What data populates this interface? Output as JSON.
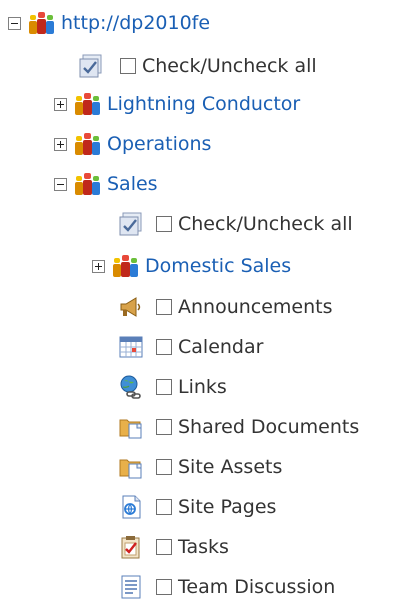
{
  "tree": {
    "root": {
      "label": "http://dp2010fe",
      "check_all_label": "Check/Uncheck all"
    },
    "subsites": [
      {
        "label": "Lightning Conductor"
      },
      {
        "label": "Operations"
      },
      {
        "label": "Sales"
      }
    ],
    "sales": {
      "check_all_label": "Check/Uncheck all",
      "subsite_label": "Domestic Sales",
      "lists": [
        {
          "label": "Announcements",
          "icon": "announcements-icon"
        },
        {
          "label": "Calendar",
          "icon": "calendar-icon"
        },
        {
          "label": "Links",
          "icon": "links-icon"
        },
        {
          "label": "Shared Documents",
          "icon": "document-library-icon"
        },
        {
          "label": "Site Assets",
          "icon": "document-library-icon"
        },
        {
          "label": "Site Pages",
          "icon": "site-pages-icon"
        },
        {
          "label": "Tasks",
          "icon": "tasks-icon"
        },
        {
          "label": "Team Discussion",
          "icon": "discussion-icon"
        }
      ]
    }
  },
  "colors": {
    "link": "#1a5fb4",
    "text": "#333333"
  }
}
